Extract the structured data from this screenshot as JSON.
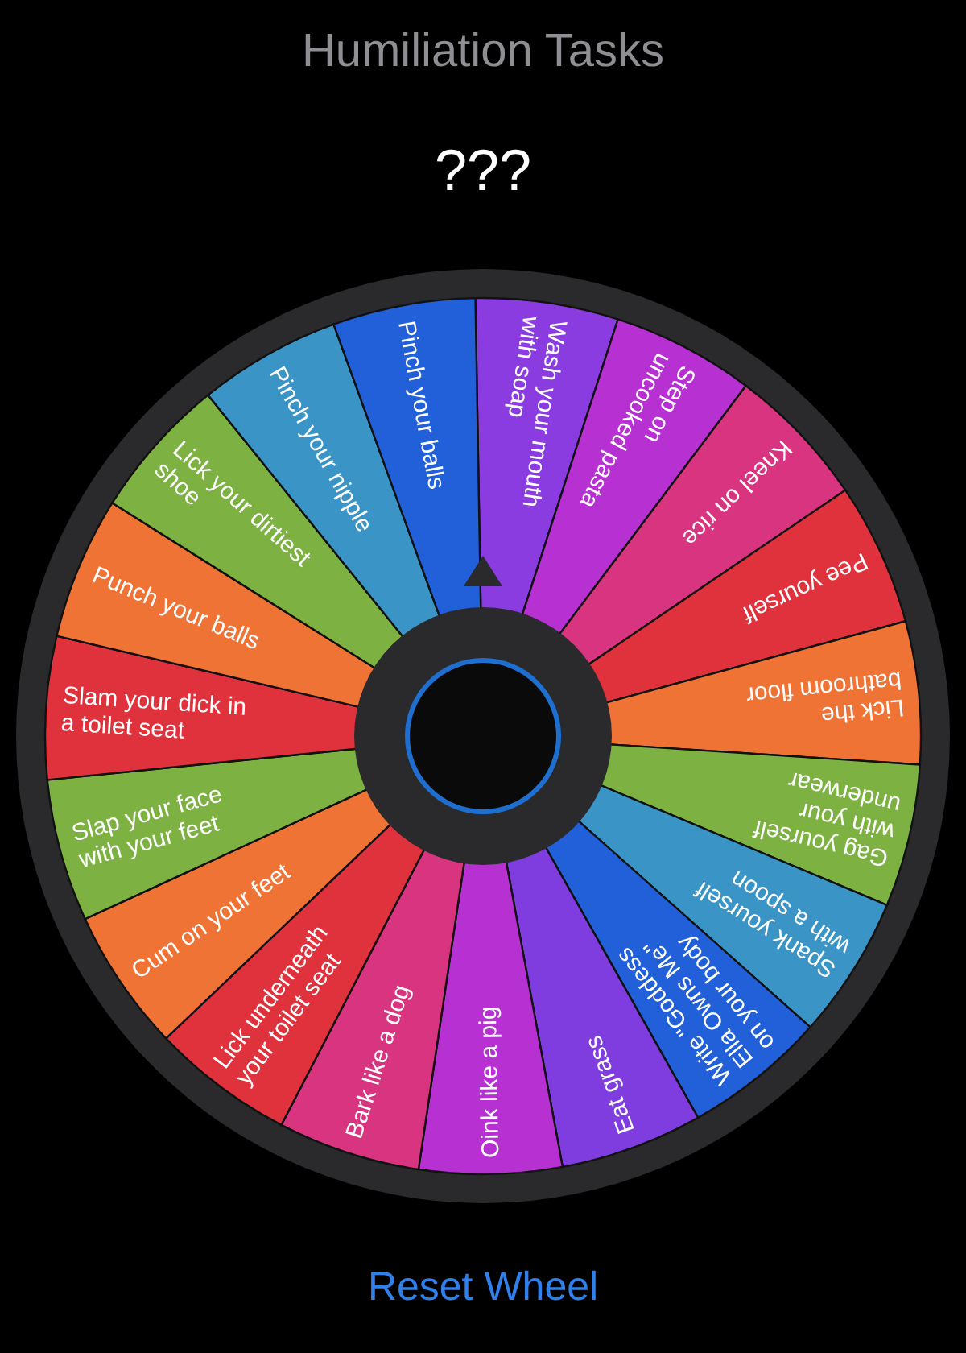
{
  "app": {
    "title": "Humiliation Tasks",
    "result": "???"
  },
  "wheel": {
    "segments": [
      {
        "lines": [
          "Wash your mouth",
          "with soap"
        ],
        "color": "#8a3ce0"
      },
      {
        "lines": [
          "Step on",
          "uncooked pasta"
        ],
        "color": "#b630d2"
      },
      {
        "lines": [
          "Kneel on rice"
        ],
        "color": "#d9347f"
      },
      {
        "lines": [
          "Pee yourself"
        ],
        "color": "#e0323c"
      },
      {
        "lines": [
          "Lick the",
          "bathroom floor"
        ],
        "color": "#f07336"
      },
      {
        "lines": [
          "Gag yourself",
          "with your",
          "underwear"
        ],
        "color": "#7db242"
      },
      {
        "lines": [
          "Spank yourself",
          "with a spoon"
        ],
        "color": "#3a94c6"
      },
      {
        "lines": [
          "Write \"Goddess",
          "Ella Owns Me\"",
          "on your body"
        ],
        "color": "#2160d8"
      },
      {
        "lines": [
          "Eat grass"
        ],
        "color": "#7f3de0"
      },
      {
        "lines": [
          "Oink like a pig"
        ],
        "color": "#b630d2"
      },
      {
        "lines": [
          "Bark like a dog"
        ],
        "color": "#d9347f"
      },
      {
        "lines": [
          "Lick underneath",
          "your toilet seat"
        ],
        "color": "#e0323c"
      },
      {
        "lines": [
          "Cum on your feet"
        ],
        "color": "#f07336"
      },
      {
        "lines": [
          "Slap your face",
          "with your feet"
        ],
        "color": "#7db242"
      },
      {
        "lines": [
          "Slam your dick in",
          "a toilet seat"
        ],
        "color": "#e0323c"
      },
      {
        "lines": [
          "Punch your balls"
        ],
        "color": "#f07336"
      },
      {
        "lines": [
          "Lick your dirtiest",
          "shoe"
        ],
        "color": "#7db242"
      },
      {
        "lines": [
          "Pinch your nipple"
        ],
        "color": "#3a94c6"
      },
      {
        "lines": [
          "Pinch your balls"
        ],
        "color": "#2160d8"
      }
    ]
  },
  "reset_button": "Reset Wheel"
}
